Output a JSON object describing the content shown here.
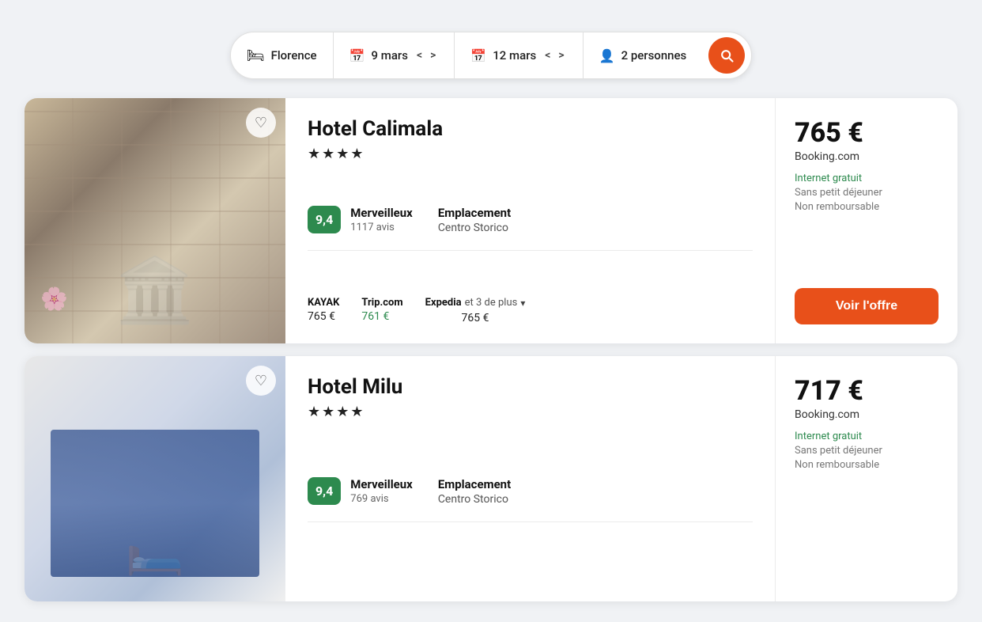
{
  "searchBar": {
    "destination": "Florence",
    "checkin": "9 mars",
    "checkout": "12 mars",
    "guests": "2 personnes",
    "searchLabel": "Rechercher"
  },
  "hotels": [
    {
      "id": "hotel-calimala",
      "name": "Hotel Calimala",
      "stars": 4,
      "rating": {
        "score": "9,4",
        "label": "Merveilleux",
        "reviews": "1117 avis"
      },
      "location": {
        "label": "Emplacement",
        "value": "Centro Storico"
      },
      "price": {
        "amount": "765 €",
        "provider": "Booking.com",
        "features": [
          {
            "text": "Internet gratuit",
            "style": "green"
          },
          {
            "text": "Sans petit déjeuner",
            "style": "gray"
          },
          {
            "text": "Non remboursable",
            "style": "gray"
          }
        ],
        "cta": "Voir l'offre"
      },
      "priceSources": [
        {
          "name": "KAYAK",
          "amount": "765 €",
          "green": false
        },
        {
          "name": "Trip.com",
          "amount": "761 €",
          "green": true
        },
        {
          "name": "Expedia",
          "amount": "765 €",
          "green": false,
          "extra": "et 3 de plus"
        }
      ]
    },
    {
      "id": "hotel-milu",
      "name": "Hotel Milu",
      "stars": 4,
      "rating": {
        "score": "9,4",
        "label": "Merveilleux",
        "reviews": "769 avis"
      },
      "location": {
        "label": "Emplacement",
        "value": "Centro Storico"
      },
      "price": {
        "amount": "717 €",
        "provider": "Booking.com",
        "features": [
          {
            "text": "Internet gratuit",
            "style": "green"
          },
          {
            "text": "Sans petit déjeuner",
            "style": "gray"
          },
          {
            "text": "Non remboursable",
            "style": "gray"
          }
        ],
        "cta": "Voir l'offre"
      },
      "priceSources": []
    }
  ],
  "icons": {
    "bed": "🛏",
    "calendar": "📅",
    "person": "👤",
    "search": "🔍",
    "heart": "♡",
    "star": "★",
    "chevronLeft": "<",
    "chevronRight": ">",
    "chevronDown": "▾"
  }
}
